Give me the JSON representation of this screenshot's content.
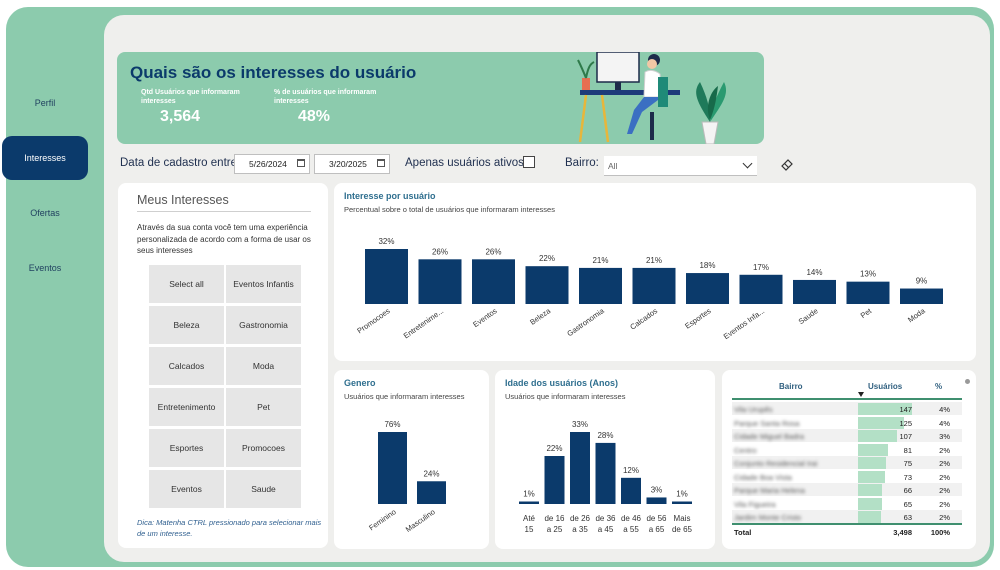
{
  "nav": {
    "items": [
      {
        "label": "Perfil",
        "active": false
      },
      {
        "label": "Interesses",
        "active": true
      },
      {
        "label": "Ofertas",
        "active": false
      },
      {
        "label": "Eventos",
        "active": false
      }
    ]
  },
  "header": {
    "title": "Quais são os interesses do usuário",
    "kpi1_label": "Qtd Usuários que informaram interesses",
    "kpi1_value": "3,564",
    "kpi2_label": "% de usuários que informaram interesses",
    "kpi2_value": "48%"
  },
  "filters": {
    "date_label": "Data de cadastro entre:",
    "date_start": "5/26/2024",
    "date_end": "3/20/2025",
    "active_label": "Apenas usuários ativos:",
    "bairro_label": "Bairro:",
    "bairro_value": "All"
  },
  "interests": {
    "title": "Meus Interesses",
    "description": "Através da sua conta você tem uma experiência personalizada de acordo com a forma de usar os seus interesses",
    "options": [
      "Select all",
      "Eventos Infantis",
      "Beleza",
      "Gastronomia",
      "Calcados",
      "Moda",
      "Entretenimento",
      "Pet",
      "Esportes",
      "Promocoes",
      "Eventos",
      "Saude"
    ],
    "tip": "Dica: Matenha CTRL pressionado para selecionar mais de um interesse."
  },
  "charts": {
    "interest": {
      "title": "Interesse por usuário",
      "subtitle": "Percentual sobre o total de usuários que informaram interesses"
    },
    "gender": {
      "title": "Genero",
      "subtitle": "Usuários que informaram interesses"
    },
    "age": {
      "title": "Idade dos usuários (Anos)",
      "subtitle": "Usuários que informaram interesses"
    }
  },
  "chart_data": [
    {
      "type": "bar",
      "categories": [
        "Promocoes",
        "Entretenime...",
        "Eventos",
        "Beleza",
        "Gastronomia",
        "Calcados",
        "Esportes",
        "Eventos Infa...",
        "Saude",
        "Pet",
        "Moda"
      ],
      "values": [
        32,
        26,
        26,
        22,
        21,
        21,
        18,
        17,
        14,
        13,
        9
      ],
      "labels": [
        "32%",
        "26%",
        "26%",
        "22%",
        "21%",
        "21%",
        "18%",
        "17%",
        "14%",
        "13%",
        "9%"
      ],
      "title": "Interesse por usuário",
      "color": "#0b3a6b"
    },
    {
      "type": "bar",
      "categories": [
        "Feminino",
        "Masculino"
      ],
      "values": [
        76,
        24
      ],
      "labels": [
        "76%",
        "24%"
      ],
      "title": "Genero",
      "color": "#0b3a6b"
    },
    {
      "type": "bar",
      "categories": [
        "Até 15",
        "de 16 a 25",
        "de 26 a 35",
        "de 36 a 45",
        "de 46 a 55",
        "de 56 a 65",
        "Mais de 65"
      ],
      "category_lines": [
        [
          "Até",
          "15"
        ],
        [
          "de 16",
          "a 25"
        ],
        [
          "de 26",
          "a 35"
        ],
        [
          "de 36",
          "a 45"
        ],
        [
          "de 46",
          "a 55"
        ],
        [
          "de 56",
          "a 65"
        ],
        [
          "Mais",
          "de 65"
        ]
      ],
      "values": [
        1,
        22,
        33,
        28,
        12,
        3,
        1
      ],
      "labels": [
        "1%",
        "22%",
        "33%",
        "28%",
        "12%",
        "3%",
        "1%"
      ],
      "title": "Idade dos usuários (Anos)",
      "color": "#0b3a6b"
    },
    {
      "type": "table",
      "columns": [
        "Bairro",
        "Usuários",
        "%"
      ],
      "rows": [
        {
          "bairro": "Vila Urupês",
          "usuarios": 147,
          "pct": "4%"
        },
        {
          "bairro": "Parque Santa Rosa",
          "usuarios": 125,
          "pct": "4%"
        },
        {
          "bairro": "Cidade Miguel Badra",
          "usuarios": 107,
          "pct": "3%"
        },
        {
          "bairro": "Centro",
          "usuarios": 81,
          "pct": "2%"
        },
        {
          "bairro": "Conjunto Residencial Irai",
          "usuarios": 75,
          "pct": "2%"
        },
        {
          "bairro": "Cidade Boa Vista",
          "usuarios": 73,
          "pct": "2%"
        },
        {
          "bairro": "Parque Maria Helena",
          "usuarios": 66,
          "pct": "2%"
        },
        {
          "bairro": "Vila Figueira",
          "usuarios": 65,
          "pct": "2%"
        },
        {
          "bairro": "Jardim Monte Cristo",
          "usuarios": 63,
          "pct": "2%"
        }
      ],
      "total": {
        "label": "Total",
        "usuarios": "3,498",
        "pct": "100%"
      }
    }
  ]
}
